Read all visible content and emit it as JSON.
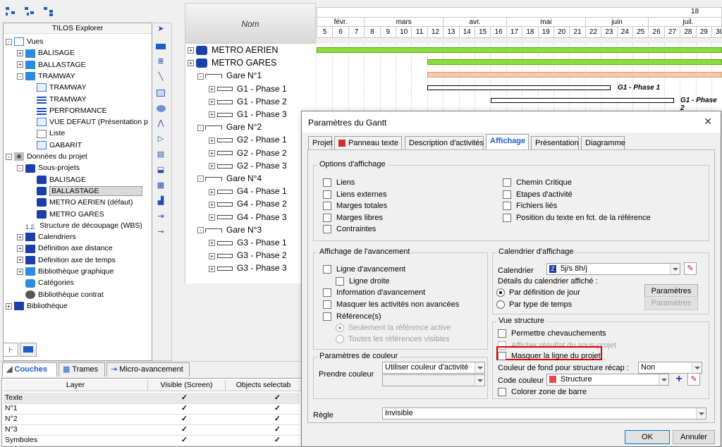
{
  "explorer": {
    "title": "TILOS Explorer",
    "tree": [
      {
        "label": "Vues",
        "level": 0,
        "pm": "-",
        "icon": "views-icon"
      },
      {
        "label": "BALISAGE",
        "level": 1,
        "pm": "+",
        "icon": "folder-icon"
      },
      {
        "label": "BALLASTAGE",
        "level": 1,
        "pm": "+",
        "icon": "folder-icon"
      },
      {
        "label": "TRAMWAY",
        "level": 1,
        "pm": "-",
        "icon": "folder-icon"
      },
      {
        "label": "TRAMWAY",
        "level": 2,
        "pm": "",
        "icon": "view-icon"
      },
      {
        "label": "TRAMWAY",
        "level": 2,
        "pm": "",
        "icon": "gantt-view-icon"
      },
      {
        "label": "PERFORMANCE",
        "level": 2,
        "pm": "",
        "icon": "gantt-view-icon"
      },
      {
        "label": "VUE DEFAUT (Présentation p",
        "level": 2,
        "pm": "",
        "icon": "view-icon"
      },
      {
        "label": "Liste",
        "level": 2,
        "pm": "",
        "icon": "list-icon"
      },
      {
        "label": "GABARIT",
        "level": 2,
        "pm": "",
        "icon": "view-icon"
      },
      {
        "label": "Données du projet",
        "level": 0,
        "pm": "-",
        "icon": "project-data-icon"
      },
      {
        "label": "Sous-projets",
        "level": 1,
        "pm": "-",
        "icon": "subprojects-icon"
      },
      {
        "label": "BALISAGE",
        "level": 2,
        "pm": "",
        "icon": "subproject-icon"
      },
      {
        "label": "BALLASTAGE",
        "level": 2,
        "pm": "",
        "icon": "subproject-icon",
        "selected": true
      },
      {
        "label": "METRO AERIEN (défaut)",
        "level": 2,
        "pm": "",
        "icon": "subproject-icon"
      },
      {
        "label": "METRO GARES",
        "level": 2,
        "pm": "",
        "icon": "subproject-icon"
      },
      {
        "label": "Structure de découpage (WBS)",
        "level": 1,
        "pm": "",
        "icon": "wbs-icon"
      },
      {
        "label": "Calendriers",
        "level": 1,
        "pm": "+",
        "icon": "calendar-icon"
      },
      {
        "label": "Définition axe distance",
        "level": 1,
        "pm": "+",
        "icon": "distance-axis-icon"
      },
      {
        "label": "Définition axe de temps",
        "level": 1,
        "pm": "+",
        "icon": "time-axis-icon"
      },
      {
        "label": "Bibliothèque graphique",
        "level": 1,
        "pm": "+",
        "icon": "graphic-library-icon"
      },
      {
        "label": "Catégories",
        "level": 1,
        "pm": "",
        "icon": "categories-icon"
      },
      {
        "label": "Bibliothèque contrat",
        "level": 1,
        "pm": "",
        "icon": "contract-library-icon"
      },
      {
        "label": "Bibliothèque",
        "level": 0,
        "pm": "+",
        "icon": "library-icon"
      }
    ],
    "wbs_prefix": "1.2."
  },
  "bottom_tabs": {
    "couches": "Couches",
    "trames": "Trames",
    "micro": "Micro-avancement"
  },
  "layers": {
    "headers": [
      "Layer",
      "Visible (Screen)",
      "Objects  selectab"
    ],
    "rows": [
      {
        "name": "Texte",
        "visible": "✓",
        "selectable": "✓"
      },
      {
        "name": "N°1",
        "visible": "✓",
        "selectable": "✓"
      },
      {
        "name": "N°2",
        "visible": "✓",
        "selectable": "✓"
      },
      {
        "name": "N°3",
        "visible": "✓",
        "selectable": "✓"
      },
      {
        "name": "Symboles",
        "visible": "✓",
        "selectable": "✓"
      }
    ]
  },
  "gantt": {
    "name_header": "Nom",
    "year": "18",
    "months": [
      "févr.",
      "mars",
      "avr.",
      "mai",
      "juin",
      "juil."
    ],
    "weeks": [
      "5",
      "6",
      "7",
      "8",
      "9",
      "10",
      "11",
      "12",
      "13",
      "14",
      "15",
      "16",
      "17",
      "18",
      "19",
      "20",
      "21",
      "22",
      "23",
      "24",
      "25",
      "26",
      "27",
      "28",
      "29",
      "30"
    ],
    "rows": [
      {
        "label": "METRO AERIEN",
        "level": 0,
        "type": "project"
      },
      {
        "label": "METRO GARES",
        "level": 0,
        "type": "project"
      },
      {
        "label": "Gare N°1",
        "level": 1,
        "type": "gare"
      },
      {
        "label": "G1 - Phase 1",
        "level": 2,
        "type": "phase"
      },
      {
        "label": "G1 - Phase 2",
        "level": 2,
        "type": "phase"
      },
      {
        "label": "G1 - Phase 3",
        "level": 2,
        "type": "phase"
      },
      {
        "label": "Gare N°2",
        "level": 1,
        "type": "gare"
      },
      {
        "label": "G2 - Phase 1",
        "level": 2,
        "type": "phase"
      },
      {
        "label": "G2 - Phase 2",
        "level": 2,
        "type": "phase"
      },
      {
        "label": "G2 - Phase 3",
        "level": 2,
        "type": "phase"
      },
      {
        "label": "Gare N°4",
        "level": 1,
        "type": "gare"
      },
      {
        "label": "G4 - Phase 1",
        "level": 2,
        "type": "phase"
      },
      {
        "label": "G4 - Phase 2",
        "level": 2,
        "type": "phase"
      },
      {
        "label": "G4 - Phase 3",
        "level": 2,
        "type": "phase"
      },
      {
        "label": "Gare N°3",
        "level": 1,
        "type": "gare"
      },
      {
        "label": "G3 - Phase 1",
        "level": 2,
        "type": "phase"
      },
      {
        "label": "G3 - Phase 2",
        "level": 2,
        "type": "phase"
      },
      {
        "label": "G3 - Phase 3",
        "level": 2,
        "type": "phase"
      }
    ],
    "bar_label_1": "G1 - Phase 1",
    "bar_label_2": "G1 - Phase 2",
    "colors": {
      "green": "#8ddd3a",
      "orange": "#f9c8a8"
    }
  },
  "dialog": {
    "title": "Paramètres du Gantt",
    "close": "✕",
    "tabs": [
      "Projet",
      "Panneau texte",
      "Description d'activités",
      "Affichage",
      "Présentation",
      "Diagramme"
    ],
    "active_tab": "Affichage",
    "options": {
      "title": "Options d'affichage",
      "left": [
        "Liens",
        "Liens externes",
        "Marges totales",
        "Marges libres",
        "Contraintes"
      ],
      "right": [
        "Chemin Critique",
        "Etapes d'activité",
        "Fichiers liés",
        "Position du texte en fct. de la référence"
      ]
    },
    "avancement": {
      "title": "Affichage de l'avancement",
      "ligne": "Ligne d'avancement",
      "ligne_droite": "Ligne droite",
      "information": "Information d'avancement",
      "masquer": "Masquer les activités non avancées",
      "references": "Référence(s)",
      "seulement": "Seulement la référence active",
      "toutes": "Toutes les références visibles"
    },
    "couleur": {
      "title": "Paramètres de couleur",
      "label": "Prendre couleur",
      "value": "Utiliser couleur d'activité",
      "value2": ""
    },
    "calendrier": {
      "title": "Calendrier d'affichage",
      "label": "Calendrier",
      "value": "5j/s 8h/j",
      "details": "Détails du calendrier affiché :",
      "par_jour": "Par définition de jour",
      "par_type": "Par type de temps",
      "btn1": "Paramètres",
      "btn2": "Paramètres"
    },
    "structure": {
      "title": "Vue structure",
      "chevauchements": "Permettre chevauchements",
      "afficher": "Afficher résultat du sous-projet",
      "masquer": "Masquer la ligne du projet",
      "fond_label": "Couleur de fond pour structure récap :",
      "fond_value": "Non",
      "code_label": "Code couleur :",
      "code_value": "Structure",
      "colorer": "Colorer zone de barre"
    },
    "regle": {
      "label": "Règle",
      "value": "Invisible"
    },
    "ok": "OK",
    "cancel": "Annuler",
    "highlight_color": "#e00000"
  }
}
